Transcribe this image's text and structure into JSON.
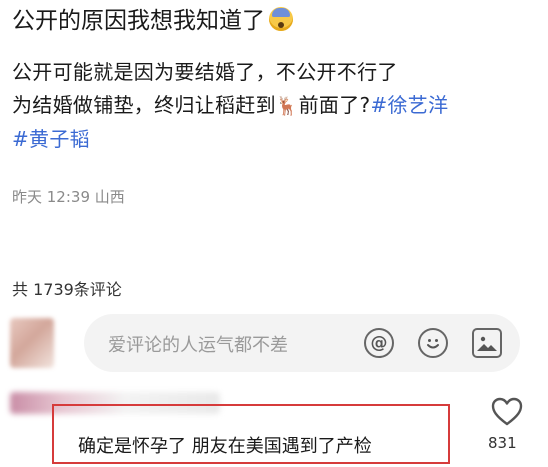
{
  "post": {
    "title": "公开的原因我想我知道了",
    "title_emoji": "fearful-face-emoji",
    "body_line1": "公开可能就是因为要结婚了，不公开不行了",
    "body_line2": "为结婚做铺垫，终归让稻赶到",
    "deer_emoji": "🦌",
    "body_line2_tail": "前面了?",
    "tag1": "#徐艺洋",
    "tag2": "#黄子韬",
    "meta": "昨天 12:39 山西"
  },
  "comments": {
    "count_label": "共 1739条评论",
    "input_placeholder": "爱评论的人运气都不差",
    "icons": [
      "at-icon",
      "smile-icon",
      "image-icon"
    ],
    "first_comment_text": "确定是怀孕了 朋友在美国遇到了产检",
    "first_comment_likes": "831"
  },
  "colors": {
    "tag": "#3b6ad3",
    "highlight_border": "#d63b3b",
    "input_bg": "#f3f3f3"
  }
}
